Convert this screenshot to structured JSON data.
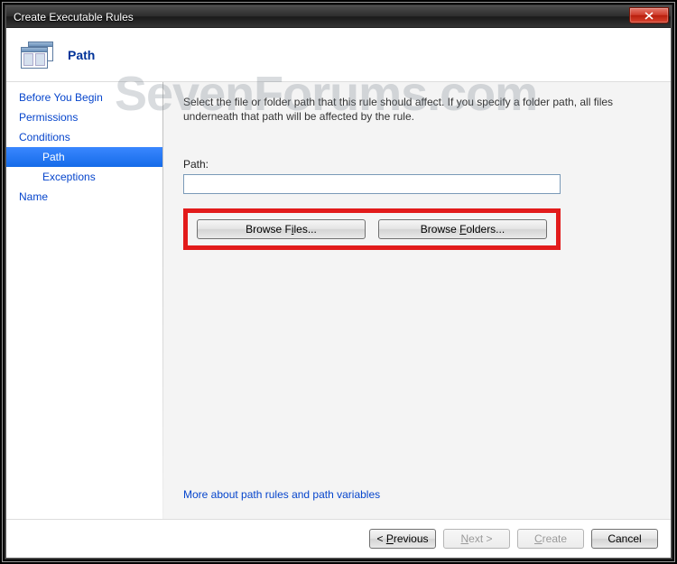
{
  "window": {
    "title": "Create Executable Rules"
  },
  "header": {
    "page_title": "Path"
  },
  "watermark": "SevenForums.com",
  "sidebar": {
    "items": [
      {
        "label": "Before You Begin",
        "sub": false,
        "selected": false
      },
      {
        "label": "Permissions",
        "sub": false,
        "selected": false
      },
      {
        "label": "Conditions",
        "sub": false,
        "selected": false
      },
      {
        "label": "Path",
        "sub": true,
        "selected": true
      },
      {
        "label": "Exceptions",
        "sub": true,
        "selected": false
      },
      {
        "label": "Name",
        "sub": false,
        "selected": false
      }
    ]
  },
  "main": {
    "description": "Select the file or folder path that this rule should affect. If you specify a folder path, all files underneath that path will be affected by the rule.",
    "path_label": "Path:",
    "path_value": "",
    "browse_files_pre": "Browse F",
    "browse_files_u": "i",
    "browse_files_post": "les...",
    "browse_folders_pre": "Browse ",
    "browse_folders_u": "F",
    "browse_folders_post": "olders...",
    "help_link": "More about path rules and path variables"
  },
  "footer": {
    "previous_pre": "< ",
    "previous_u": "P",
    "previous_post": "revious",
    "next_u": "N",
    "next_post": "ext >",
    "create_u": "C",
    "create_post": "reate",
    "cancel": "Cancel"
  }
}
